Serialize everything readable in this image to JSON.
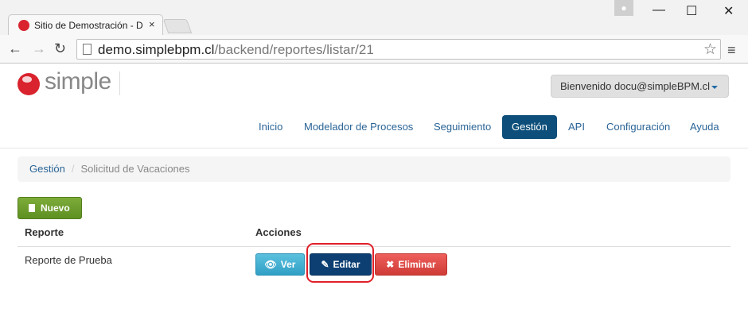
{
  "browser": {
    "tab_title": "Sitio de Demostración - D",
    "tab_close": "×",
    "url_host": "demo.simplebpm.cl",
    "url_path": "/backend/reportes/listar/21",
    "back": "←",
    "forward": "→",
    "reload": "↻",
    "star": "☆",
    "menu": "≡",
    "minimize": "—",
    "maximize": "☐",
    "close": "✕"
  },
  "header": {
    "logo_text": "simple",
    "user_button": "Bienvenido docu@simpleBPM.cl"
  },
  "nav": [
    {
      "label": "Inicio",
      "active": false
    },
    {
      "label": "Modelador de Procesos",
      "active": false
    },
    {
      "label": "Seguimiento",
      "active": false
    },
    {
      "label": "Gestión",
      "active": true
    },
    {
      "label": "API",
      "active": false
    },
    {
      "label": "Configuración",
      "active": false
    },
    {
      "label": "Ayuda",
      "active": false
    }
  ],
  "breadcrumb": {
    "link": "Gestión",
    "separator": "/",
    "current": "Solicitud de Vacaciones"
  },
  "actions": {
    "new_button": "Nuevo"
  },
  "table": {
    "headers": [
      "Reporte",
      "Acciones"
    ],
    "rows": [
      {
        "name": "Reporte de Prueba",
        "buttons": [
          "Ver",
          "Editar",
          "Eliminar"
        ]
      }
    ]
  },
  "icons": {
    "eye": "eye-icon",
    "edit": "edit-icon",
    "delete": "times-icon",
    "document": "document-icon"
  },
  "colors": {
    "nav_active": "#0d4f7a",
    "nuevo": "#6c9c2c",
    "ver": "#4ab3d6",
    "editar": "#0d3f73",
    "eliminar": "#da4b47",
    "highlight": "#e0202a"
  }
}
